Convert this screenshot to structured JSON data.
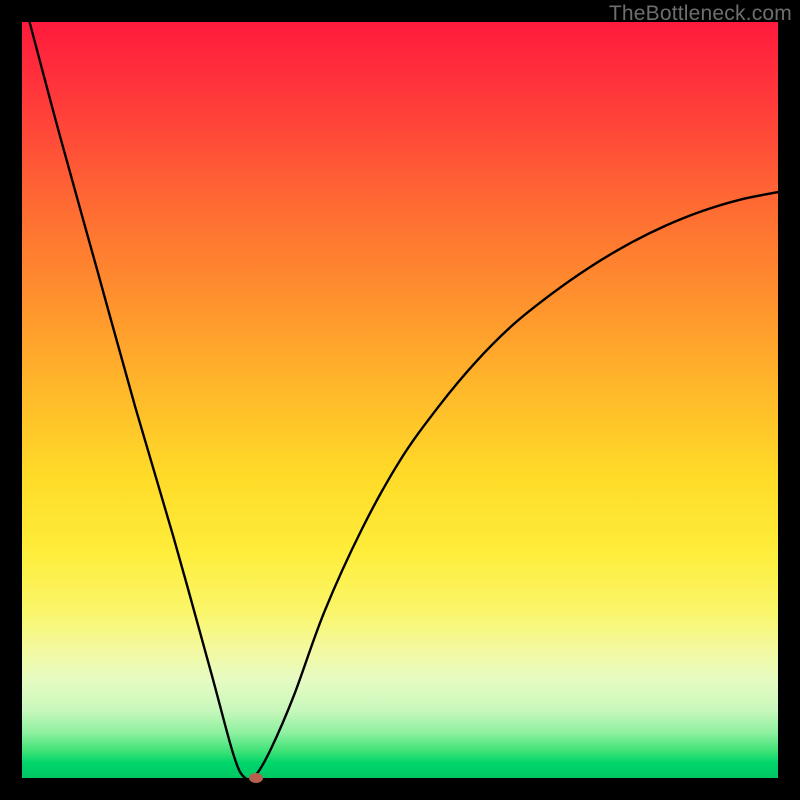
{
  "watermark": "TheBottleneck.com",
  "colors": {
    "frame_bg": "#000000",
    "curve_stroke": "#000000",
    "marker_fill": "#b8604f"
  },
  "chart_data": {
    "type": "line",
    "title": "",
    "xlabel": "",
    "ylabel": "",
    "xlim": [
      0,
      100
    ],
    "ylim": [
      0,
      100
    ],
    "grid": false,
    "series": [
      {
        "name": "bottleneck-curve",
        "x": [
          1,
          5,
          10,
          15,
          20,
          25,
          28,
          29.5,
          31,
          33,
          36,
          40,
          45,
          50,
          55,
          60,
          65,
          70,
          75,
          80,
          85,
          90,
          95,
          100
        ],
        "y": [
          100,
          85,
          67,
          49,
          32,
          14,
          3,
          0,
          0.5,
          4,
          11,
          22,
          33,
          42,
          49,
          55,
          60,
          64,
          67.5,
          70.5,
          73,
          75,
          76.5,
          77.5
        ]
      }
    ],
    "marker": {
      "x": 31,
      "y": 0
    }
  }
}
